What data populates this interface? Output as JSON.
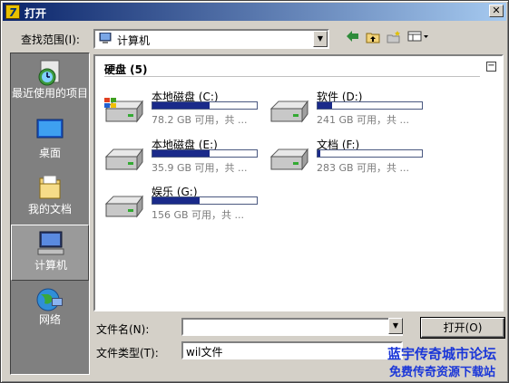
{
  "dialog": {
    "title": "打开",
    "icon_letter": "7"
  },
  "lookin": {
    "label": "查找范围(I):",
    "value": "计算机"
  },
  "toolbar": {
    "back_icon": "back-arrow-icon",
    "up_icon": "up-folder-icon",
    "new_folder_icon": "new-folder-icon",
    "views_icon": "views-menu-icon"
  },
  "places": [
    {
      "label": "最近使用的项目",
      "icon": "recent-items-icon"
    },
    {
      "label": "桌面",
      "icon": "desktop-icon"
    },
    {
      "label": "我的文档",
      "icon": "my-documents-icon"
    },
    {
      "label": "计算机",
      "icon": "computer-icon"
    },
    {
      "label": "网络",
      "icon": "network-icon"
    }
  ],
  "filelist": {
    "group_title": "硬盘 (5)",
    "collapse_symbol": "−",
    "drives": [
      {
        "name": "本地磁盘 (C:)",
        "free": "78.2 GB 可用，共 ...",
        "used_fraction": 0.55,
        "system": true
      },
      {
        "name": "软件 (D:)",
        "free": "241 GB 可用，共 ...",
        "used_fraction": 0.14
      },
      {
        "name": "本地磁盘 (E:)",
        "free": "35.9 GB 可用，共 ...",
        "used_fraction": 0.55
      },
      {
        "name": "文档 (F:)",
        "free": "283 GB 可用，共 ...",
        "used_fraction": 0.03
      },
      {
        "name": "娱乐 (G:)",
        "free": "156 GB 可用，共 ...",
        "used_fraction": 0.45
      }
    ]
  },
  "filename": {
    "label": "文件名(N):",
    "value": ""
  },
  "filetype": {
    "label": "文件类型(T):",
    "value": "wil文件"
  },
  "buttons": {
    "open": "打开(O)"
  },
  "watermark": {
    "line1": "蓝宇传奇城市论坛",
    "line2": "免费传奇资源下载站"
  },
  "colors": {
    "titlebar_start": "#0a246a",
    "titlebar_end": "#a6caf0",
    "usage_bar": "#1a2a8a",
    "watermark": "#1a36d8"
  }
}
